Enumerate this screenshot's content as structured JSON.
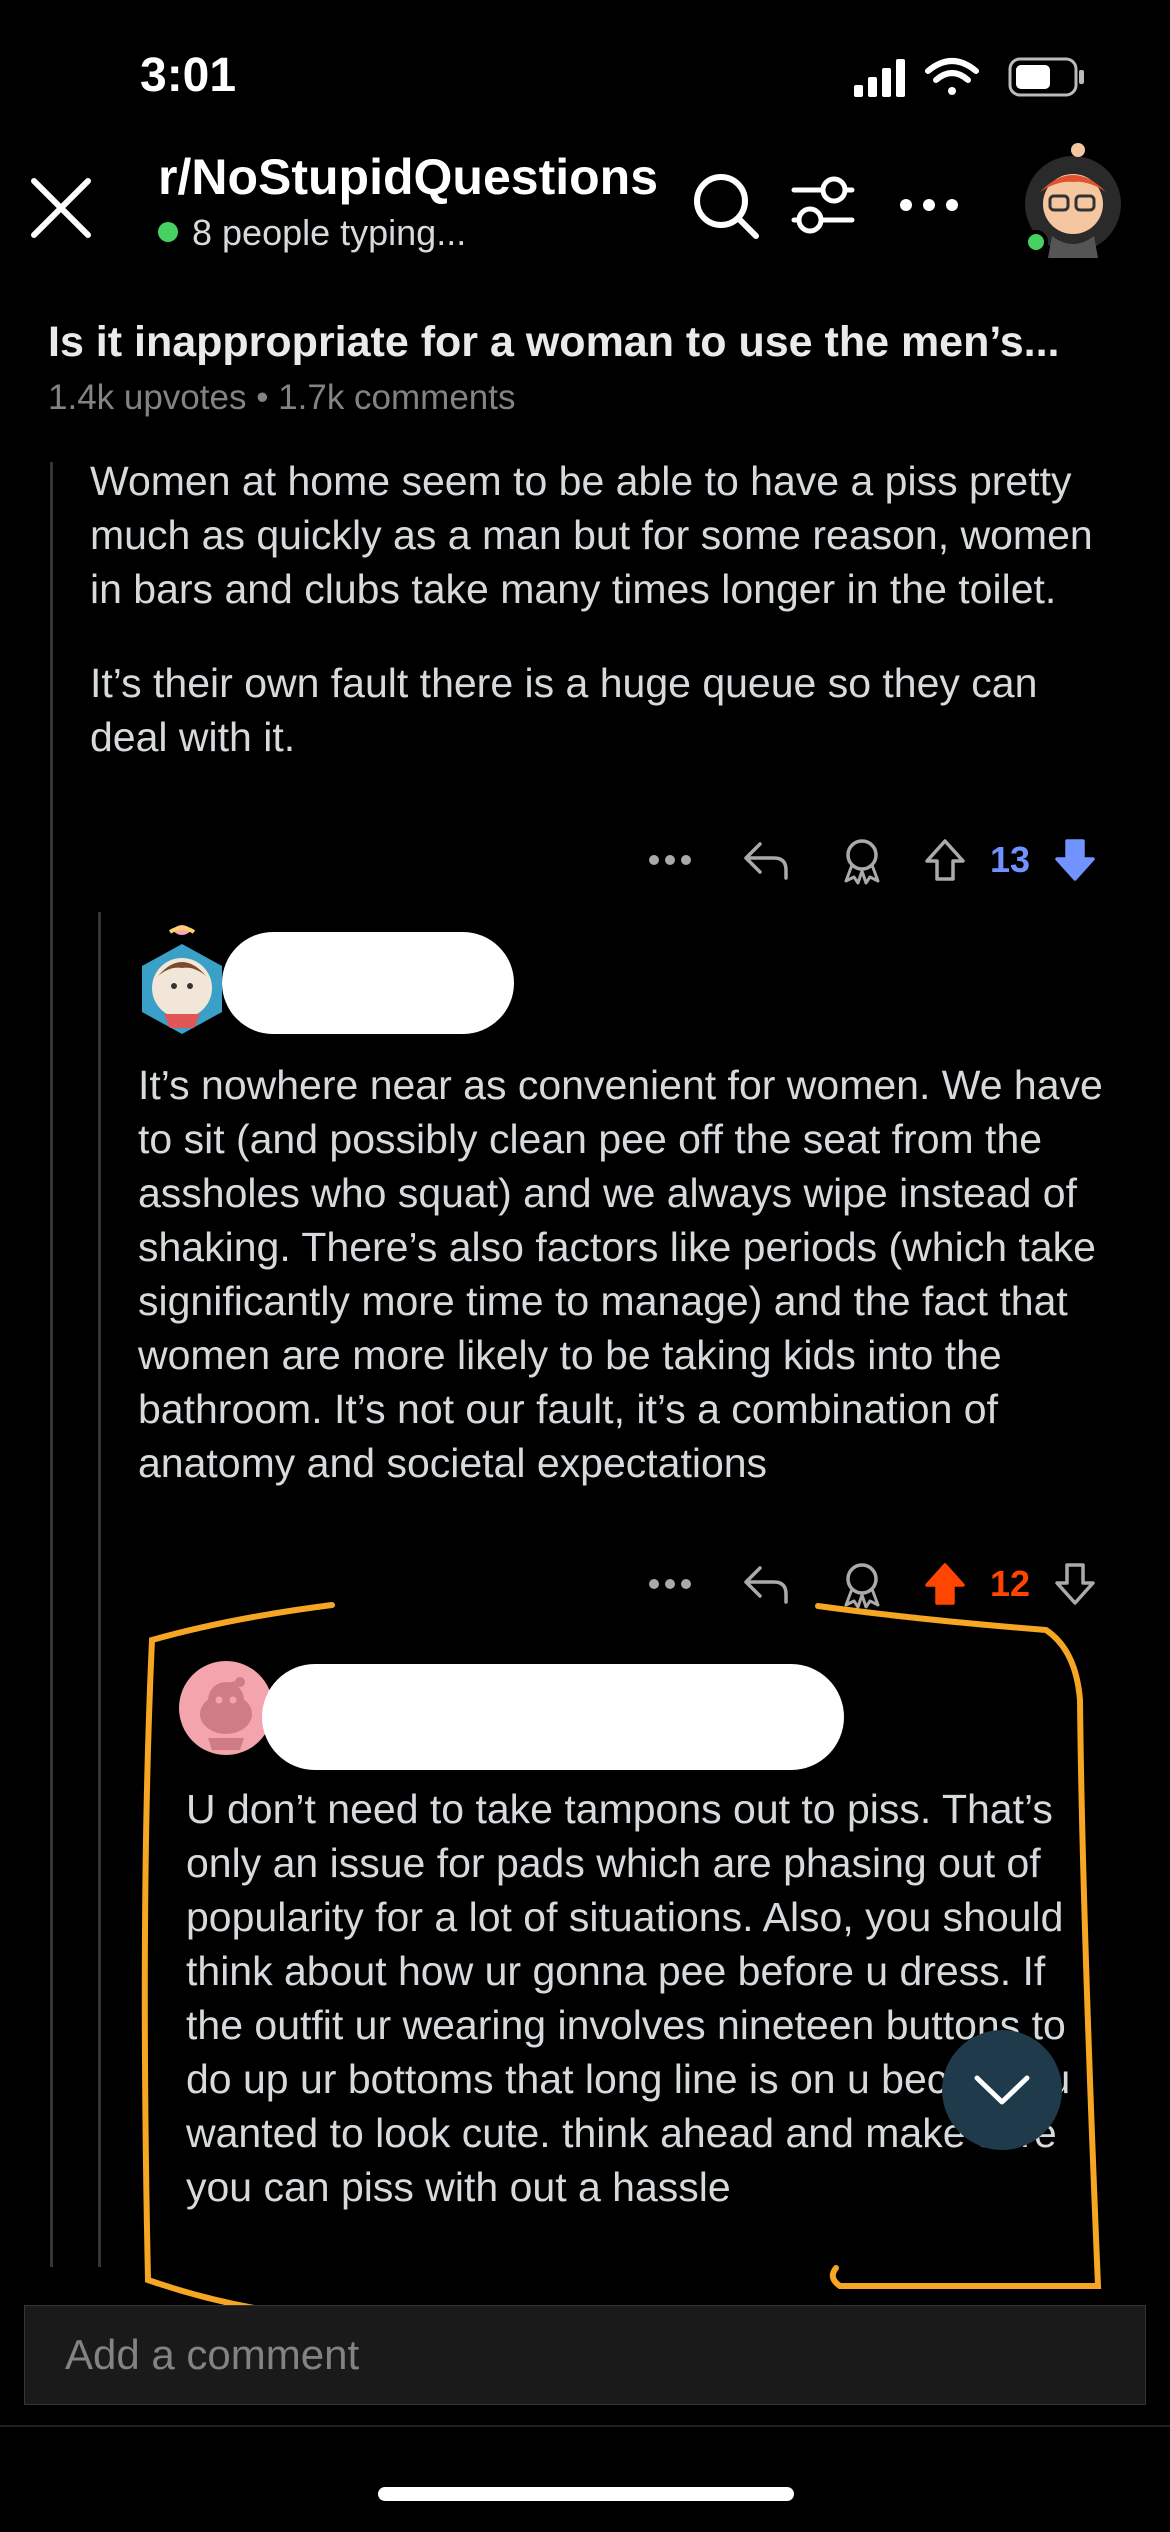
{
  "status_bar": {
    "time": "3:01"
  },
  "header": {
    "subreddit": "r/NoStupidQuestions",
    "typing_status": "8 people typing..."
  },
  "post": {
    "title": "Is it inappropriate for a woman to use the men’s...",
    "meta": "1.4k upvotes • 1.7k comments"
  },
  "comments": [
    {
      "paragraphs": [
        "Women at home seem to be able to have a piss pretty much as quickly as a man but for some reason, women in bars and clubs take many times longer in the toilet.",
        "It’s their own fault there is a huge queue so they can deal with it."
      ],
      "score": "13",
      "vote_state": "downvoted"
    },
    {
      "paragraphs": [
        "It’s nowhere near as convenient for women. We have to sit (and possibly clean pee off the seat from the assholes who squat) and we always wipe instead of shaking. There’s also factors like periods (which take significantly more time to manage) and the fact that women are more likely to be taking kids into the bathroom. It’s not our fault, it’s a combination of anatomy and societal expectations"
      ],
      "score": "12",
      "vote_state": "upvoted"
    },
    {
      "paragraphs": [
        "U don’t need to take tampons out to piss. That’s only an issue for pads which are phasing out of popularity for a lot of situations. Also, you should think about how ur gonna pee before u dress. If the outfit ur wearing involves nineteen buttons to do up ur bottoms that long line is on u because u wanted to look cute. think ahead and make sure you can piss with out a hassle"
      ]
    }
  ],
  "composer": {
    "placeholder": "Add a comment"
  },
  "colors": {
    "background": "#000000",
    "upvote": "#ff4500",
    "downvote": "#7193ff",
    "annotation": "#f5a623",
    "online": "#46d160"
  }
}
